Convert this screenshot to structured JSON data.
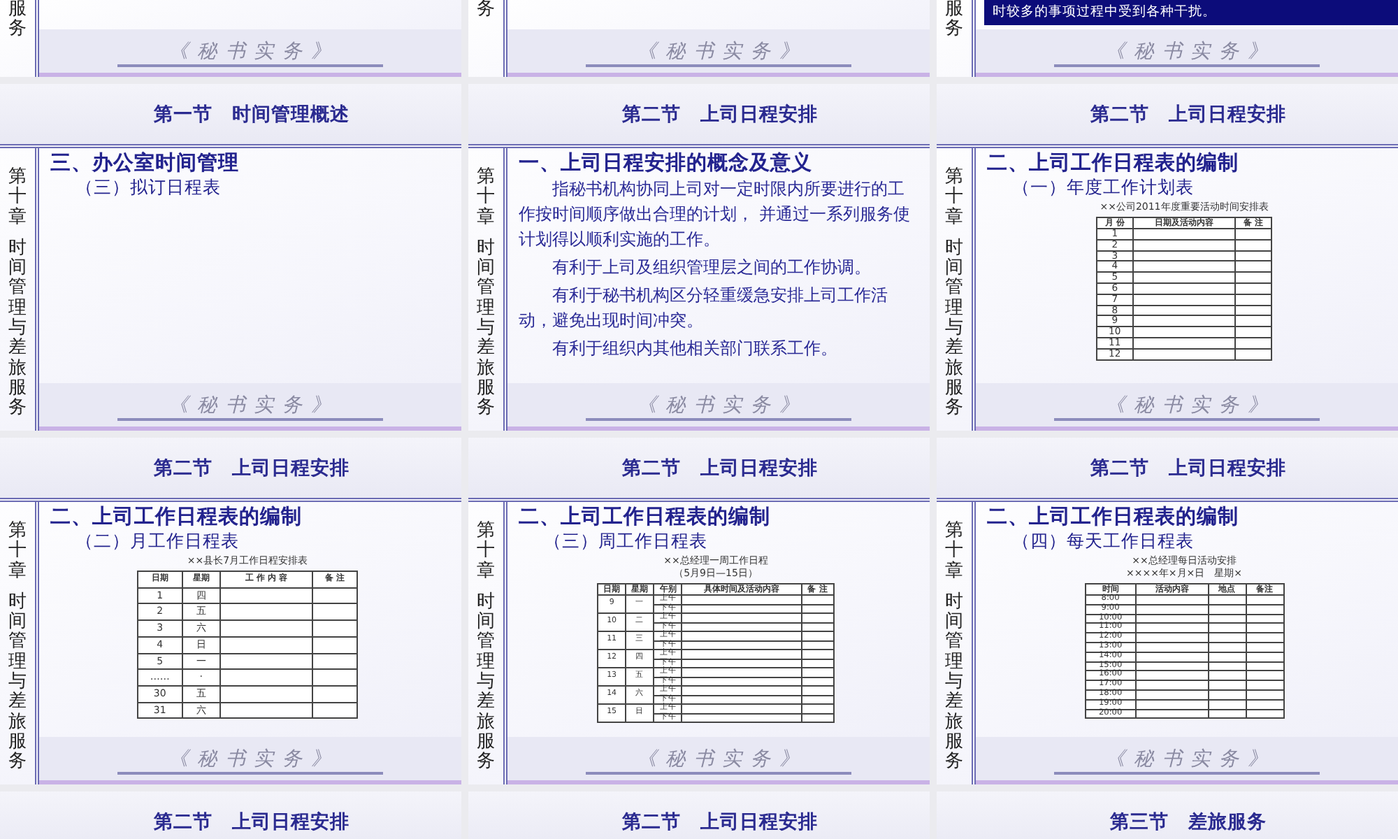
{
  "slides": [
    {
      "kind": "tail",
      "strip": [
        "服务"
      ],
      "footer": "《 秘 书 实 务 》"
    },
    {
      "kind": "tail",
      "strip": [
        "务"
      ],
      "footer": "《 秘 书 实 务 》"
    },
    {
      "kind": "tail",
      "strip": [
        "服务"
      ],
      "note": "时较多的事项过程中受到各种干扰。",
      "footer": "《 秘 书 实 务 》"
    },
    {
      "kind": "full",
      "section": "第一节　时间管理概述",
      "strip": [
        "第十章",
        "时间管理与差旅服务"
      ],
      "heading": "三、办公室时间管理",
      "subheading": "（三）拟订日程表",
      "footer": "《 秘 书 实 务 》"
    },
    {
      "kind": "full",
      "section": "第二节　上司日程安排",
      "strip": [
        "第十章",
        "时间管理与差旅服务"
      ],
      "heading": "一、上司日程安排的概念及意义",
      "paragraphs": [
        "指秘书机构协同上司对一定时限内所要进行的工作按时间顺序做出合理的计划， 并通过一系列服务使计划得以顺利实施的工作。",
        "有利于上司及组织管理层之间的工作协调。",
        "有利于秘书机构区分轻重缓急安排上司工作活动，避免出现时间冲突。",
        "有利于组织内其他相关部门联系工作。"
      ],
      "footer": "《 秘 书 实 务 》"
    },
    {
      "kind": "full",
      "section": "第二节　上司日程安排",
      "strip": [
        "第十章",
        "时间管理与差旅服务"
      ],
      "heading": "二、上司工作日程表的编制",
      "subheading": "（一）年度工作计划表",
      "table": {
        "kind": "grid",
        "title": "××公司2011年度重要活动时间安排表",
        "columns": [
          "月 份",
          "日期及活动内容",
          "备 注"
        ],
        "rows": [
          [
            "1"
          ],
          [
            "2"
          ],
          [
            "3"
          ],
          [
            "4"
          ],
          [
            "5"
          ],
          [
            "6"
          ],
          [
            "7"
          ],
          [
            "8"
          ],
          [
            "9"
          ],
          [
            "10"
          ],
          [
            "11"
          ],
          [
            "12"
          ]
        ]
      },
      "footer": "《 秘 书 实 务 》"
    },
    {
      "kind": "full",
      "section": "第二节　上司日程安排",
      "strip": [
        "第十章",
        "时间管理与差旅服务"
      ],
      "heading": "二、上司工作日程表的编制",
      "subheading": "（二）月工作日程表",
      "table": {
        "kind": "grid",
        "title": "××县长7月工作日程安排表",
        "columns": [
          "日期",
          "星期",
          "工 作 内 容",
          "备 注"
        ],
        "rows": [
          [
            "1",
            "四"
          ],
          [
            "2",
            "五"
          ],
          [
            "3",
            "六"
          ],
          [
            "4",
            "日"
          ],
          [
            "5",
            "一"
          ],
          [
            "……",
            "·"
          ],
          [
            "30",
            "五"
          ],
          [
            "31",
            "六"
          ]
        ]
      },
      "footer": "《 秘 书 实 务 》"
    },
    {
      "kind": "full",
      "section": "第二节　上司日程安排",
      "strip": [
        "第十章",
        "时间管理与差旅服务"
      ],
      "heading": "二、上司工作日程表的编制",
      "subheading": "（三）周工作日程表",
      "table": {
        "kind": "split",
        "title": "××总经理一周工作日程",
        "subtitle": "（5月9日—15日）",
        "columns": [
          "日期",
          "星期",
          "午别",
          "具体时间及活动内容",
          "备 注"
        ],
        "rows": [
          {
            "cells": [
              "9",
              "一"
            ],
            "halves": [
              "上午",
              "下午"
            ]
          },
          {
            "cells": [
              "10",
              "二"
            ],
            "halves": [
              "上午",
              "下午"
            ]
          },
          {
            "cells": [
              "11",
              "三"
            ],
            "halves": [
              "上午",
              "下午"
            ]
          },
          {
            "cells": [
              "12",
              "四"
            ],
            "halves": [
              "上午",
              "下午"
            ]
          },
          {
            "cells": [
              "13",
              "五"
            ],
            "halves": [
              "上午",
              "下午"
            ]
          },
          {
            "cells": [
              "14",
              "六"
            ],
            "halves": [
              "上午",
              "下午"
            ]
          },
          {
            "cells": [
              "15",
              "日"
            ],
            "halves": [
              "上午",
              "下午"
            ]
          }
        ]
      },
      "footer": "《 秘 书 实 务 》"
    },
    {
      "kind": "full",
      "section": "第二节　上司日程安排",
      "strip": [
        "第十章",
        "时间管理与差旅服务"
      ],
      "heading": "二、上司工作日程表的编制",
      "subheading": "（四）每天工作日程表",
      "table": {
        "kind": "grid",
        "title": "××总经理每日活动安排",
        "subtitle": "××××年×月×日　星期×",
        "columns": [
          "时间",
          "活动内容",
          "地点",
          "备注"
        ],
        "rows": [
          [
            "8:00"
          ],
          [
            "9:00"
          ],
          [
            "10:00"
          ],
          [
            "11:00"
          ],
          [
            "12:00"
          ],
          [
            "13:00"
          ],
          [
            "14:00"
          ],
          [
            "15:00"
          ],
          [
            "16:00"
          ],
          [
            "17:00"
          ],
          [
            "18:00"
          ],
          [
            "19:00"
          ],
          [
            "20:00"
          ]
        ]
      },
      "footer": "《 秘 书 实 务 》"
    },
    {
      "kind": "head",
      "section": "第二节　上司日程安排"
    },
    {
      "kind": "head",
      "section": "第二节　上司日程安排"
    },
    {
      "kind": "head",
      "section": "第三节　差旅服务"
    }
  ]
}
